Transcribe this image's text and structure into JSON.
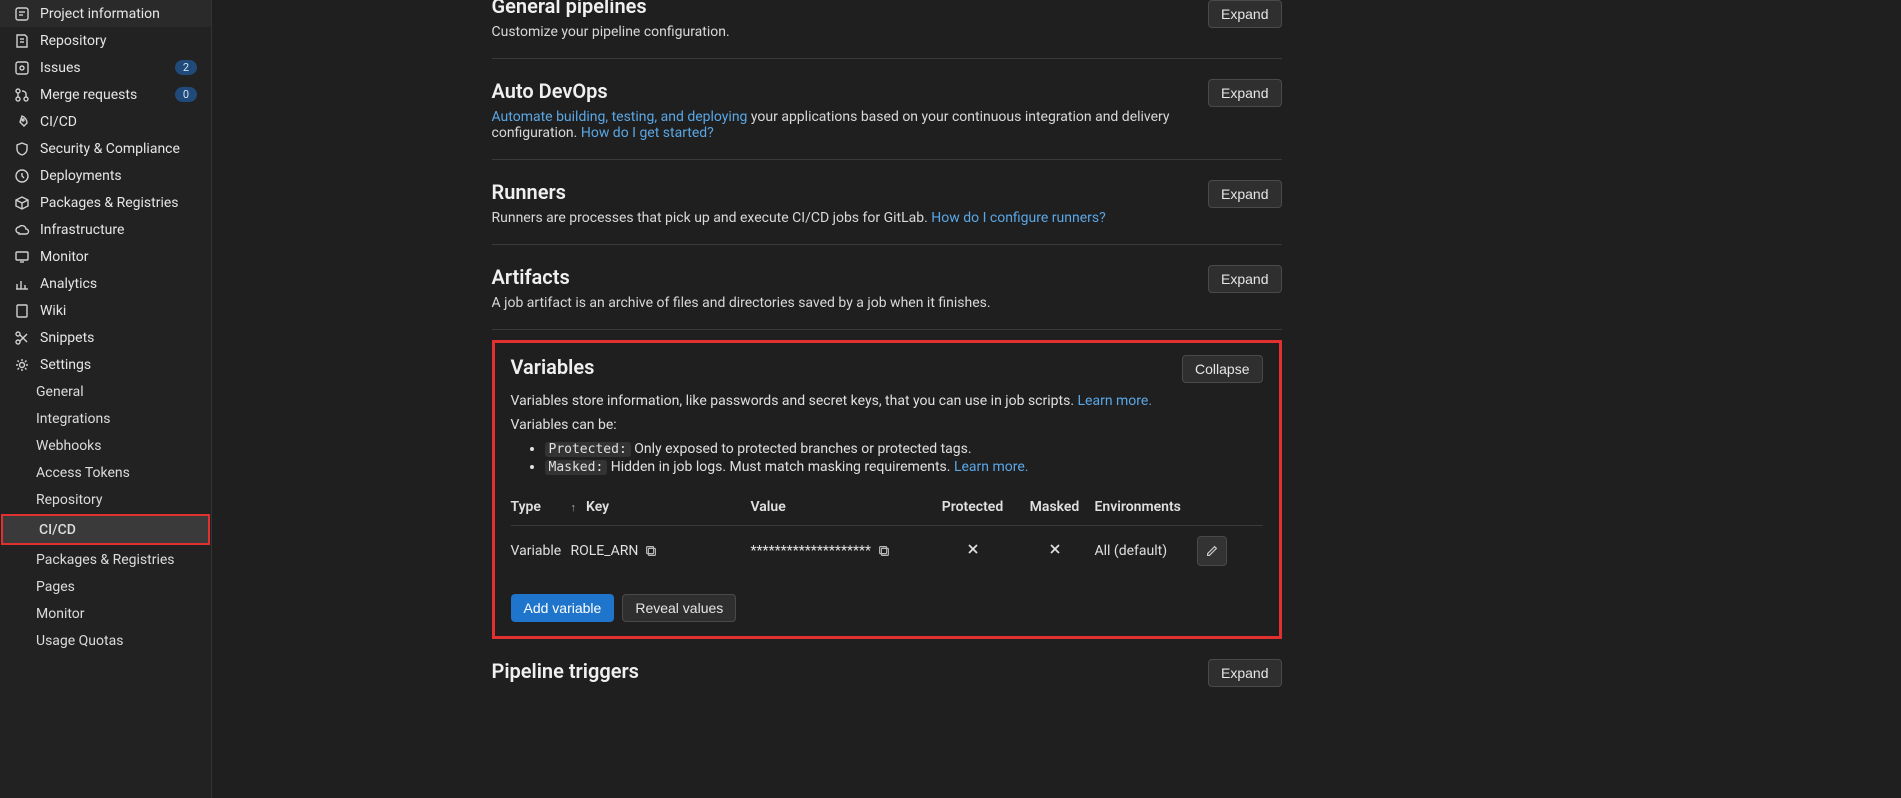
{
  "sidebar": {
    "items": [
      {
        "label": "Project information"
      },
      {
        "label": "Repository"
      },
      {
        "label": "Issues",
        "badge": "2"
      },
      {
        "label": "Merge requests",
        "badge": "0"
      },
      {
        "label": "CI/CD"
      },
      {
        "label": "Security & Compliance"
      },
      {
        "label": "Deployments"
      },
      {
        "label": "Packages & Registries"
      },
      {
        "label": "Infrastructure"
      },
      {
        "label": "Monitor"
      },
      {
        "label": "Analytics"
      },
      {
        "label": "Wiki"
      },
      {
        "label": "Snippets"
      },
      {
        "label": "Settings"
      }
    ],
    "subitems": [
      {
        "label": "General"
      },
      {
        "label": "Integrations"
      },
      {
        "label": "Webhooks"
      },
      {
        "label": "Access Tokens"
      },
      {
        "label": "Repository"
      },
      {
        "label": "CI/CD"
      },
      {
        "label": "Packages & Registries"
      },
      {
        "label": "Pages"
      },
      {
        "label": "Monitor"
      },
      {
        "label": "Usage Quotas"
      }
    ]
  },
  "sections": {
    "general": {
      "title": "General pipelines",
      "desc": "Customize your pipeline configuration.",
      "expand": "Expand"
    },
    "autodevops": {
      "title": "Auto DevOps",
      "link1": "Automate building, testing, and deploying",
      "desc": " your applications based on your continuous integration and delivery configuration. ",
      "link2": "How do I get started?",
      "expand": "Expand"
    },
    "runners": {
      "title": "Runners",
      "desc": "Runners are processes that pick up and execute CI/CD jobs for GitLab. ",
      "link": "How do I configure runners?",
      "expand": "Expand"
    },
    "artifacts": {
      "title": "Artifacts",
      "desc": "A job artifact is an archive of files and directories saved by a job when it finishes.",
      "expand": "Expand"
    },
    "variables": {
      "title": "Variables",
      "collapse": "Collapse",
      "desc1": "Variables store information, like passwords and secret keys, that you can use in job scripts. ",
      "learn1": "Learn more.",
      "desc2": "Variables can be:",
      "protected_label": "Protected:",
      "protected_text": " Only exposed to protected branches or protected tags.",
      "masked_label": "Masked:",
      "masked_text": " Hidden in job logs. Must match masking requirements. ",
      "learn2": "Learn more.",
      "headers": {
        "type": "Type",
        "key": "Key",
        "value": "Value",
        "protected": "Protected",
        "masked": "Masked",
        "env": "Environments"
      },
      "row": {
        "type": "Variable",
        "key": "ROLE_ARN",
        "value": "********************",
        "env": "All (default)"
      },
      "add": "Add variable",
      "reveal": "Reveal values"
    },
    "triggers": {
      "title": "Pipeline triggers",
      "expand": "Expand"
    }
  }
}
